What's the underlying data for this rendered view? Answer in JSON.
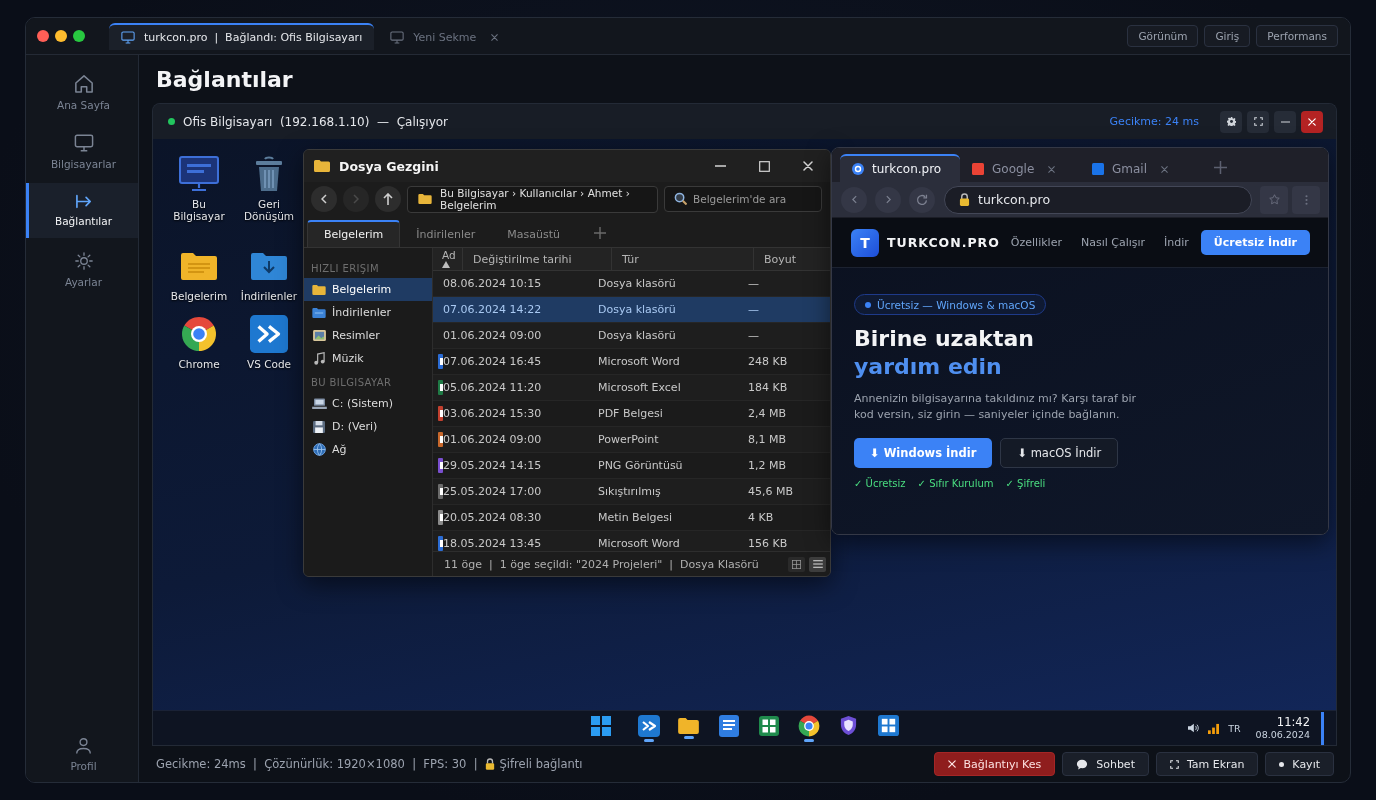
{
  "app_window": {
    "tabs": [
      {
        "label": "turkcon.pro  |  Bağlandı: Ofis Bilgisayarı",
        "selected": true
      },
      {
        "label": "Yeni Sekme",
        "selected": false
      }
    ],
    "toolbar_buttons": [
      "Görünüm",
      "Giriş",
      "Performans"
    ]
  },
  "sidebar": {
    "items": [
      {
        "label": "Ana Sayfa",
        "selected": false
      },
      {
        "label": "Bilgisayarlar",
        "selected": false
      },
      {
        "label": "Bağlantılar",
        "selected": true
      },
      {
        "label": "Ayarlar",
        "selected": false
      }
    ],
    "profile": {
      "label": "Profil"
    }
  },
  "page_title": "Bağlantılar",
  "session": {
    "title": "Ofis Bilgisayarı  (192.168.1.10)  —  Çalışıyor",
    "connected": true,
    "latency": "Gecikme: 24 ms"
  },
  "desktop": {
    "icons": [
      {
        "label": "Bu Bilgisayar"
      },
      {
        "label": "Geri Dönüşüm"
      },
      {
        "label": "Belgelerim"
      },
      {
        "label": "İndirilenler"
      },
      {
        "label": "Chrome"
      },
      {
        "label": "VS Code"
      }
    ]
  },
  "file_explorer": {
    "title": "Dosya Gezgini",
    "nav_buttons": [
      {
        "disabled": false
      },
      {
        "disabled": true
      },
      {
        "disabled": false
      }
    ],
    "path": "Bu Bilgisayar › Kullanıcılar › Ahmet › Belgelerim",
    "search_placeholder": "Belgelerim'de ara",
    "tabs": [
      {
        "label": "Belgelerim",
        "selected": true
      },
      {
        "label": "İndirilenler",
        "selected": false
      },
      {
        "label": "Masaüstü",
        "selected": false
      }
    ],
    "sidebar": [
      {
        "heading": "HIZLI ERIŞIM",
        "items": [
          {
            "label": "Belgelerim",
            "selected": true
          },
          {
            "label": "İndirilenler",
            "selected": false
          },
          {
            "label": "Resimler",
            "selected": false
          },
          {
            "label": "Müzik",
            "selected": false
          }
        ]
      },
      {
        "heading": "BU BILGISAYAR",
        "items": [
          {
            "label": "C: (Sistem)",
            "selected": false
          },
          {
            "label": "D: (Veri)",
            "selected": false
          },
          {
            "label": "Ağ",
            "selected": false
          }
        ]
      }
    ],
    "columns": [
      {
        "label": "Ad",
        "sorted": true
      },
      {
        "label": "Değiştirilme tarihi",
        "sorted": false
      },
      {
        "label": "Tür",
        "sorted": false
      },
      {
        "label": "Boyut",
        "sorted": false
      }
    ],
    "rows": [
      {
        "modified": "08.06.2024 10:15",
        "file_type": "Dosya klasörü",
        "size": "—",
        "selected": false
      },
      {
        "modified": "07.06.2024 14:22",
        "file_type": "Dosya klasörü",
        "size": "—",
        "selected": true
      },
      {
        "modified": "01.06.2024 09:00",
        "file_type": "Dosya klasörü",
        "size": "—",
        "selected": false
      },
      {
        "modified": "07.06.2024 16:45",
        "file_type": "Microsoft Word",
        "size": "248 KB",
        "selected": false,
        "color": "#2b6cd4"
      },
      {
        "modified": "05.06.2024 11:20",
        "file_type": "Microsoft Excel",
        "size": "184 KB",
        "selected": false,
        "color": "#1f7a45"
      },
      {
        "modified": "03.06.2024 15:30",
        "file_type": "PDF Belgesi",
        "size": "2,4 MB",
        "selected": false,
        "color": "#c2402f"
      },
      {
        "modified": "01.06.2024 09:00",
        "file_type": "PowerPoint",
        "size": "8,1 MB",
        "selected": false,
        "color": "#c8682c"
      },
      {
        "modified": "29.05.2024 14:15",
        "file_type": "PNG Görüntüsü",
        "size": "1,2 MB",
        "selected": false,
        "color": "#7a4fd0"
      },
      {
        "modified": "25.05.2024 17:00",
        "file_type": "Sıkıştırılmış",
        "size": "45,6 MB",
        "selected": false,
        "color": "#6b6b6b"
      },
      {
        "modified": "20.05.2024 08:30",
        "file_type": "Metin Belgesi",
        "size": "4 KB",
        "selected": false,
        "color": "#8a8a8a"
      },
      {
        "modified": "18.05.2024 13:45",
        "file_type": "Microsoft Word",
        "size": "156 KB",
        "selected": false,
        "color": "#2b6cd4"
      }
    ],
    "status": "11 öge  |  1 öge seçildi: \"2024 Projeleri\"  |  Dosya Klasörü",
    "view_modes": [
      {
        "selected": false
      },
      {
        "selected": true
      }
    ]
  },
  "browser": {
    "tabs": [
      {
        "label": "turkcon.pro",
        "selected": true,
        "color": "#3b82f6"
      },
      {
        "label": "Google",
        "selected": false,
        "color": "#ea4335"
      },
      {
        "label": "Gmail",
        "selected": false,
        "color": "#1a73e8"
      }
    ],
    "url": "turkcon.pro",
    "page": {
      "logo_letter": "T",
      "brand": "TURKCON.PRO",
      "nav_links": [
        "Özellikler",
        "Nasıl Çalışır",
        "İndir"
      ],
      "cta": "Ücretsiz İndir",
      "badge": "Ücretsiz — Windows & macOS",
      "headline": "Birine uzaktan",
      "headline_accent": "yardım edin",
      "lead": "Annenizin bilgisayarına takıldınız mı? Karşı taraf bir kod versin, siz girin — saniyeler içinde bağlanın.",
      "buttons": [
        {
          "label": "⬇ Windows İndir",
          "kind": "primary"
        },
        {
          "label": "⬇ macOS İndir",
          "kind": "secondary"
        }
      ],
      "features": [
        "✓ Ücretsiz",
        "✓ Sıfır Kurulum",
        "✓ Şifreli"
      ]
    }
  },
  "taskbar": {
    "apps": [
      {
        "running": false
      },
      {
        "running": true
      },
      {
        "running": true
      },
      {
        "running": false
      },
      {
        "running": false
      },
      {
        "running": true
      },
      {
        "running": false
      },
      {
        "running": false
      }
    ],
    "language": "TR",
    "time": "11:42",
    "date": "08.06.2024"
  },
  "status_bar": {
    "stats": "Gecikme: 24ms  |  Çözünürlük: 1920×1080  |  FPS: 30  |",
    "secure": "Şifreli bağlantı",
    "buttons": [
      {
        "label": "Bağlantıyı Kes",
        "kind": "danger"
      },
      {
        "label": "Sohbet",
        "kind": "default"
      },
      {
        "label": "Tam Ekran",
        "kind": "default"
      },
      {
        "label": "Kayıt",
        "kind": "default"
      }
    ]
  }
}
